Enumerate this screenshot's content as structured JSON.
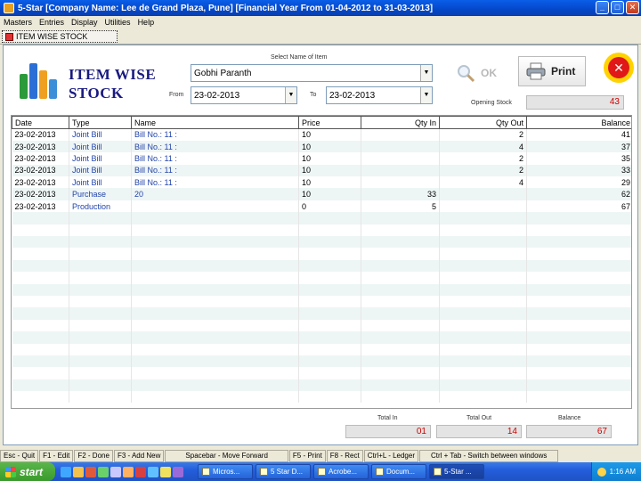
{
  "window": {
    "title": "5-Star [Company Name: Lee de Grand Plaza, Pune] [Financial Year From 01-04-2012 to 31-03-2013]",
    "btn_min": "_",
    "btn_max": "□",
    "btn_close": "✕"
  },
  "menu": [
    "Masters",
    "Entries",
    "Display",
    "Utilities",
    "Help"
  ],
  "tab": {
    "label": "ITEM WISE STOCK"
  },
  "heading": {
    "line1": "ITEM WISE",
    "line2": "STOCK"
  },
  "filters": {
    "item_label": "Select Name of Item",
    "item_value": "Gobhi Paranth",
    "from_label": "From",
    "from_value": "23-02-2013",
    "to_label": "To",
    "to_value": "23-02-2013",
    "opening_label": "Opening Stock",
    "opening_value": "43"
  },
  "buttons": {
    "ok": "OK",
    "print": "Print",
    "close": "✕"
  },
  "table": {
    "columns": [
      "Date",
      "Type",
      "Name",
      "Price",
      "Qty In",
      "Qty Out",
      "Balance"
    ],
    "rows": [
      [
        "23-02-2013",
        "Joint Bill",
        "Bill No.: 11 :",
        "10",
        "",
        "2",
        "41"
      ],
      [
        "23-02-2013",
        "Joint Bill",
        "Bill No.: 11 :",
        "10",
        "",
        "4",
        "37"
      ],
      [
        "23-02-2013",
        "Joint Bill",
        "Bill No.: 11 :",
        "10",
        "",
        "2",
        "35"
      ],
      [
        "23-02-2013",
        "Joint Bill",
        "Bill No.: 11 :",
        "10",
        "",
        "2",
        "33"
      ],
      [
        "23-02-2013",
        "Joint Bill",
        "Bill No.: 11 :",
        "10",
        "",
        "4",
        "29"
      ],
      [
        "23-02-2013",
        "Purchase",
        "20",
        "10",
        "33",
        "",
        "62"
      ],
      [
        "23-02-2013",
        "Production",
        "",
        "0",
        "5",
        "",
        "67"
      ]
    ],
    "empty_rows": 16
  },
  "totals": {
    "in_label": "Total In",
    "in_value": "01",
    "out_label": "Total Out",
    "out_value": "14",
    "bal_label": "Balance",
    "bal_value": "67"
  },
  "statusbar": [
    "Esc - Quit",
    "F1 - Edit",
    "F2 - Done",
    "F3 - Add New",
    "Spacebar - Move Forward",
    "F5 - Print",
    "F8 - Rect",
    "Ctrl+L - Ledger",
    "Ctrl + Tab - Switch between windows"
  ],
  "taskbar": {
    "start": "start",
    "tasks": [
      "Micros...",
      "5 Star D...",
      "Acrobe...",
      "Docum...",
      "5-Star ..."
    ],
    "clock": "1:16 AM"
  },
  "colors": {
    "titlebar": "#0447c8",
    "accent_red": "#cc0000",
    "heading": "#1a1a80"
  }
}
